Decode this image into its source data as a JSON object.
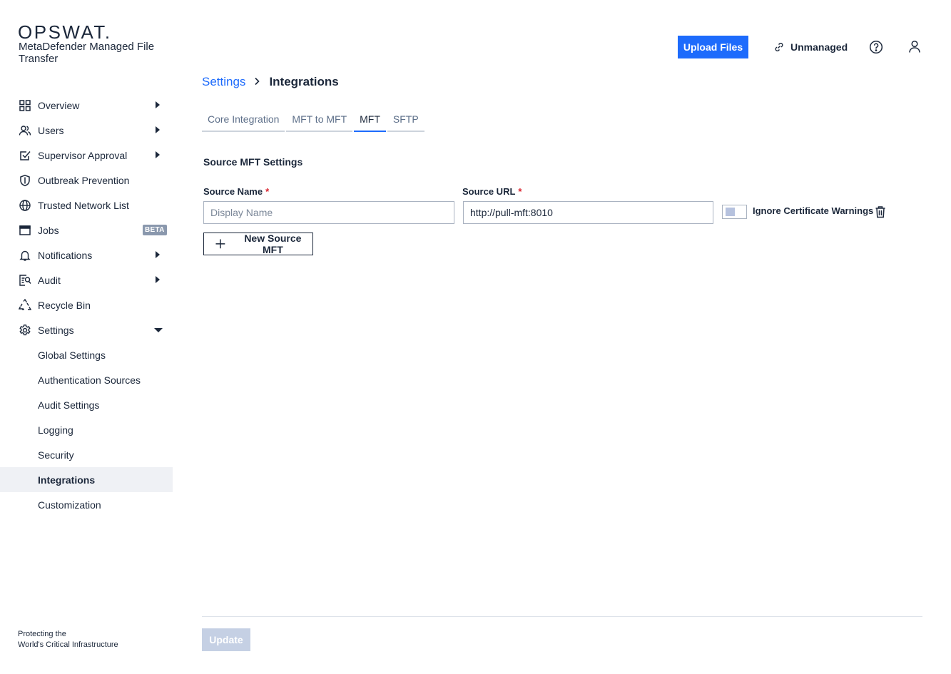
{
  "brand": {
    "logo": "OPSWAT.",
    "product": "MetaDefender Managed File Transfer",
    "tagline_line1": "Protecting the",
    "tagline_line2": "World's Critical Infrastructure"
  },
  "header": {
    "upload_label": "Upload Files",
    "unmanaged_label": "Unmanaged",
    "colors": {
      "primary": "#1d6bfc"
    }
  },
  "sidebar": {
    "items": [
      {
        "label": "Overview",
        "icon": "grid-icon"
      },
      {
        "label": "Users",
        "icon": "users-icon"
      },
      {
        "label": "Supervisor Approval",
        "icon": "checkbox-icon"
      },
      {
        "label": "Outbreak Prevention",
        "icon": "shield-icon"
      },
      {
        "label": "Trusted Network List",
        "icon": "globe-icon"
      },
      {
        "label": "Jobs",
        "icon": "window-icon",
        "badge": "BETA"
      },
      {
        "label": "Notifications",
        "icon": "bell-icon"
      },
      {
        "label": "Audit",
        "icon": "audit-icon"
      },
      {
        "label": "Recycle Bin",
        "icon": "recycle-icon"
      },
      {
        "label": "Settings",
        "icon": "gear-icon"
      }
    ],
    "settings_sub": [
      "Global Settings",
      "Authentication Sources",
      "Audit Settings",
      "Logging",
      "Security",
      "Integrations",
      "Customization"
    ]
  },
  "breadcrumb": {
    "parent": "Settings",
    "current": "Integrations"
  },
  "tabs": [
    "Core Integration",
    "MFT to MFT",
    "MFT",
    "SFTP"
  ],
  "form": {
    "section_title": "Source MFT Settings",
    "source_name_label": "Source Name",
    "source_name_placeholder": "Display Name",
    "source_url_label": "Source URL",
    "source_url_value": "http://pull-mft:8010",
    "required_mark": "*",
    "ignore_cert_label": "Ignore Certificate Warnings",
    "new_source_label": "New Source MFT"
  },
  "footer": {
    "update_label": "Update"
  }
}
